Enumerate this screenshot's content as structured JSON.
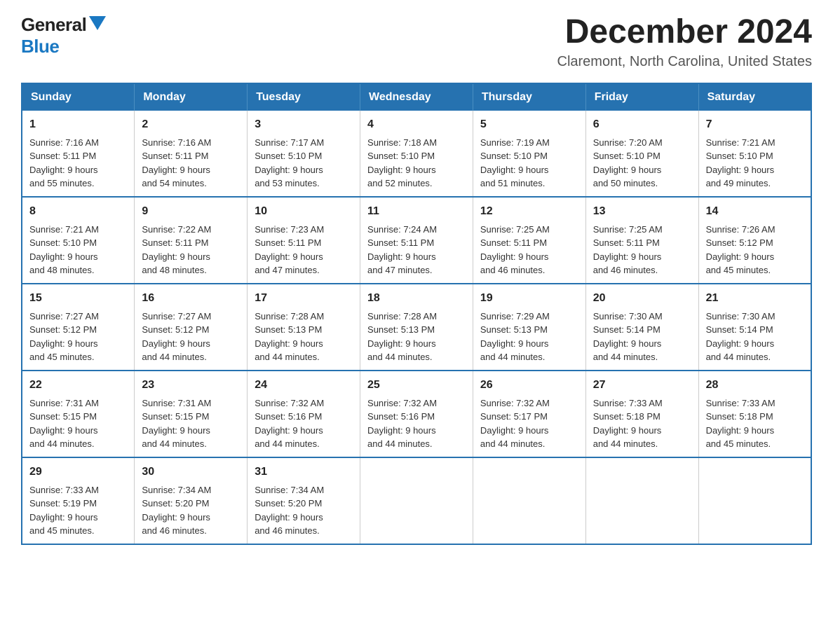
{
  "logo": {
    "text_general": "General",
    "text_blue": "Blue",
    "aria": "GeneralBlue logo"
  },
  "header": {
    "title": "December 2024",
    "subtitle": "Claremont, North Carolina, United States"
  },
  "weekdays": [
    "Sunday",
    "Monday",
    "Tuesday",
    "Wednesday",
    "Thursday",
    "Friday",
    "Saturday"
  ],
  "weeks": [
    [
      {
        "day": "1",
        "sunrise": "7:16 AM",
        "sunset": "5:11 PM",
        "daylight": "9 hours and 55 minutes."
      },
      {
        "day": "2",
        "sunrise": "7:16 AM",
        "sunset": "5:11 PM",
        "daylight": "9 hours and 54 minutes."
      },
      {
        "day": "3",
        "sunrise": "7:17 AM",
        "sunset": "5:10 PM",
        "daylight": "9 hours and 53 minutes."
      },
      {
        "day": "4",
        "sunrise": "7:18 AM",
        "sunset": "5:10 PM",
        "daylight": "9 hours and 52 minutes."
      },
      {
        "day": "5",
        "sunrise": "7:19 AM",
        "sunset": "5:10 PM",
        "daylight": "9 hours and 51 minutes."
      },
      {
        "day": "6",
        "sunrise": "7:20 AM",
        "sunset": "5:10 PM",
        "daylight": "9 hours and 50 minutes."
      },
      {
        "day": "7",
        "sunrise": "7:21 AM",
        "sunset": "5:10 PM",
        "daylight": "9 hours and 49 minutes."
      }
    ],
    [
      {
        "day": "8",
        "sunrise": "7:21 AM",
        "sunset": "5:10 PM",
        "daylight": "9 hours and 48 minutes."
      },
      {
        "day": "9",
        "sunrise": "7:22 AM",
        "sunset": "5:11 PM",
        "daylight": "9 hours and 48 minutes."
      },
      {
        "day": "10",
        "sunrise": "7:23 AM",
        "sunset": "5:11 PM",
        "daylight": "9 hours and 47 minutes."
      },
      {
        "day": "11",
        "sunrise": "7:24 AM",
        "sunset": "5:11 PM",
        "daylight": "9 hours and 47 minutes."
      },
      {
        "day": "12",
        "sunrise": "7:25 AM",
        "sunset": "5:11 PM",
        "daylight": "9 hours and 46 minutes."
      },
      {
        "day": "13",
        "sunrise": "7:25 AM",
        "sunset": "5:11 PM",
        "daylight": "9 hours and 46 minutes."
      },
      {
        "day": "14",
        "sunrise": "7:26 AM",
        "sunset": "5:12 PM",
        "daylight": "9 hours and 45 minutes."
      }
    ],
    [
      {
        "day": "15",
        "sunrise": "7:27 AM",
        "sunset": "5:12 PM",
        "daylight": "9 hours and 45 minutes."
      },
      {
        "day": "16",
        "sunrise": "7:27 AM",
        "sunset": "5:12 PM",
        "daylight": "9 hours and 44 minutes."
      },
      {
        "day": "17",
        "sunrise": "7:28 AM",
        "sunset": "5:13 PM",
        "daylight": "9 hours and 44 minutes."
      },
      {
        "day": "18",
        "sunrise": "7:28 AM",
        "sunset": "5:13 PM",
        "daylight": "9 hours and 44 minutes."
      },
      {
        "day": "19",
        "sunrise": "7:29 AM",
        "sunset": "5:13 PM",
        "daylight": "9 hours and 44 minutes."
      },
      {
        "day": "20",
        "sunrise": "7:30 AM",
        "sunset": "5:14 PM",
        "daylight": "9 hours and 44 minutes."
      },
      {
        "day": "21",
        "sunrise": "7:30 AM",
        "sunset": "5:14 PM",
        "daylight": "9 hours and 44 minutes."
      }
    ],
    [
      {
        "day": "22",
        "sunrise": "7:31 AM",
        "sunset": "5:15 PM",
        "daylight": "9 hours and 44 minutes."
      },
      {
        "day": "23",
        "sunrise": "7:31 AM",
        "sunset": "5:15 PM",
        "daylight": "9 hours and 44 minutes."
      },
      {
        "day": "24",
        "sunrise": "7:32 AM",
        "sunset": "5:16 PM",
        "daylight": "9 hours and 44 minutes."
      },
      {
        "day": "25",
        "sunrise": "7:32 AM",
        "sunset": "5:16 PM",
        "daylight": "9 hours and 44 minutes."
      },
      {
        "day": "26",
        "sunrise": "7:32 AM",
        "sunset": "5:17 PM",
        "daylight": "9 hours and 44 minutes."
      },
      {
        "day": "27",
        "sunrise": "7:33 AM",
        "sunset": "5:18 PM",
        "daylight": "9 hours and 44 minutes."
      },
      {
        "day": "28",
        "sunrise": "7:33 AM",
        "sunset": "5:18 PM",
        "daylight": "9 hours and 45 minutes."
      }
    ],
    [
      {
        "day": "29",
        "sunrise": "7:33 AM",
        "sunset": "5:19 PM",
        "daylight": "9 hours and 45 minutes."
      },
      {
        "day": "30",
        "sunrise": "7:34 AM",
        "sunset": "5:20 PM",
        "daylight": "9 hours and 46 minutes."
      },
      {
        "day": "31",
        "sunrise": "7:34 AM",
        "sunset": "5:20 PM",
        "daylight": "9 hours and 46 minutes."
      },
      null,
      null,
      null,
      null
    ]
  ],
  "labels": {
    "sunrise": "Sunrise:",
    "sunset": "Sunset:",
    "daylight": "Daylight:"
  }
}
